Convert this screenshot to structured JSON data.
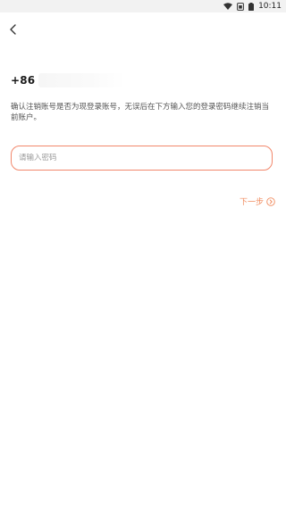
{
  "status_bar": {
    "time": "10:11",
    "icons": [
      "wifi-icon",
      "sim-icon",
      "battery-icon"
    ]
  },
  "nav": {
    "back_icon": "chevron-left-icon"
  },
  "account": {
    "country_code": "+86"
  },
  "description": "确认注销账号是否为现登录账号，无误后在下方输入您的登录密码继续注销当前账户。",
  "password": {
    "placeholder": "请输入密码",
    "value": ""
  },
  "next_step": {
    "label": "下一步",
    "icon": "arrow-right-circle-icon"
  },
  "colors": {
    "accent": "#f08a5d",
    "input_border": "#f2876b"
  }
}
